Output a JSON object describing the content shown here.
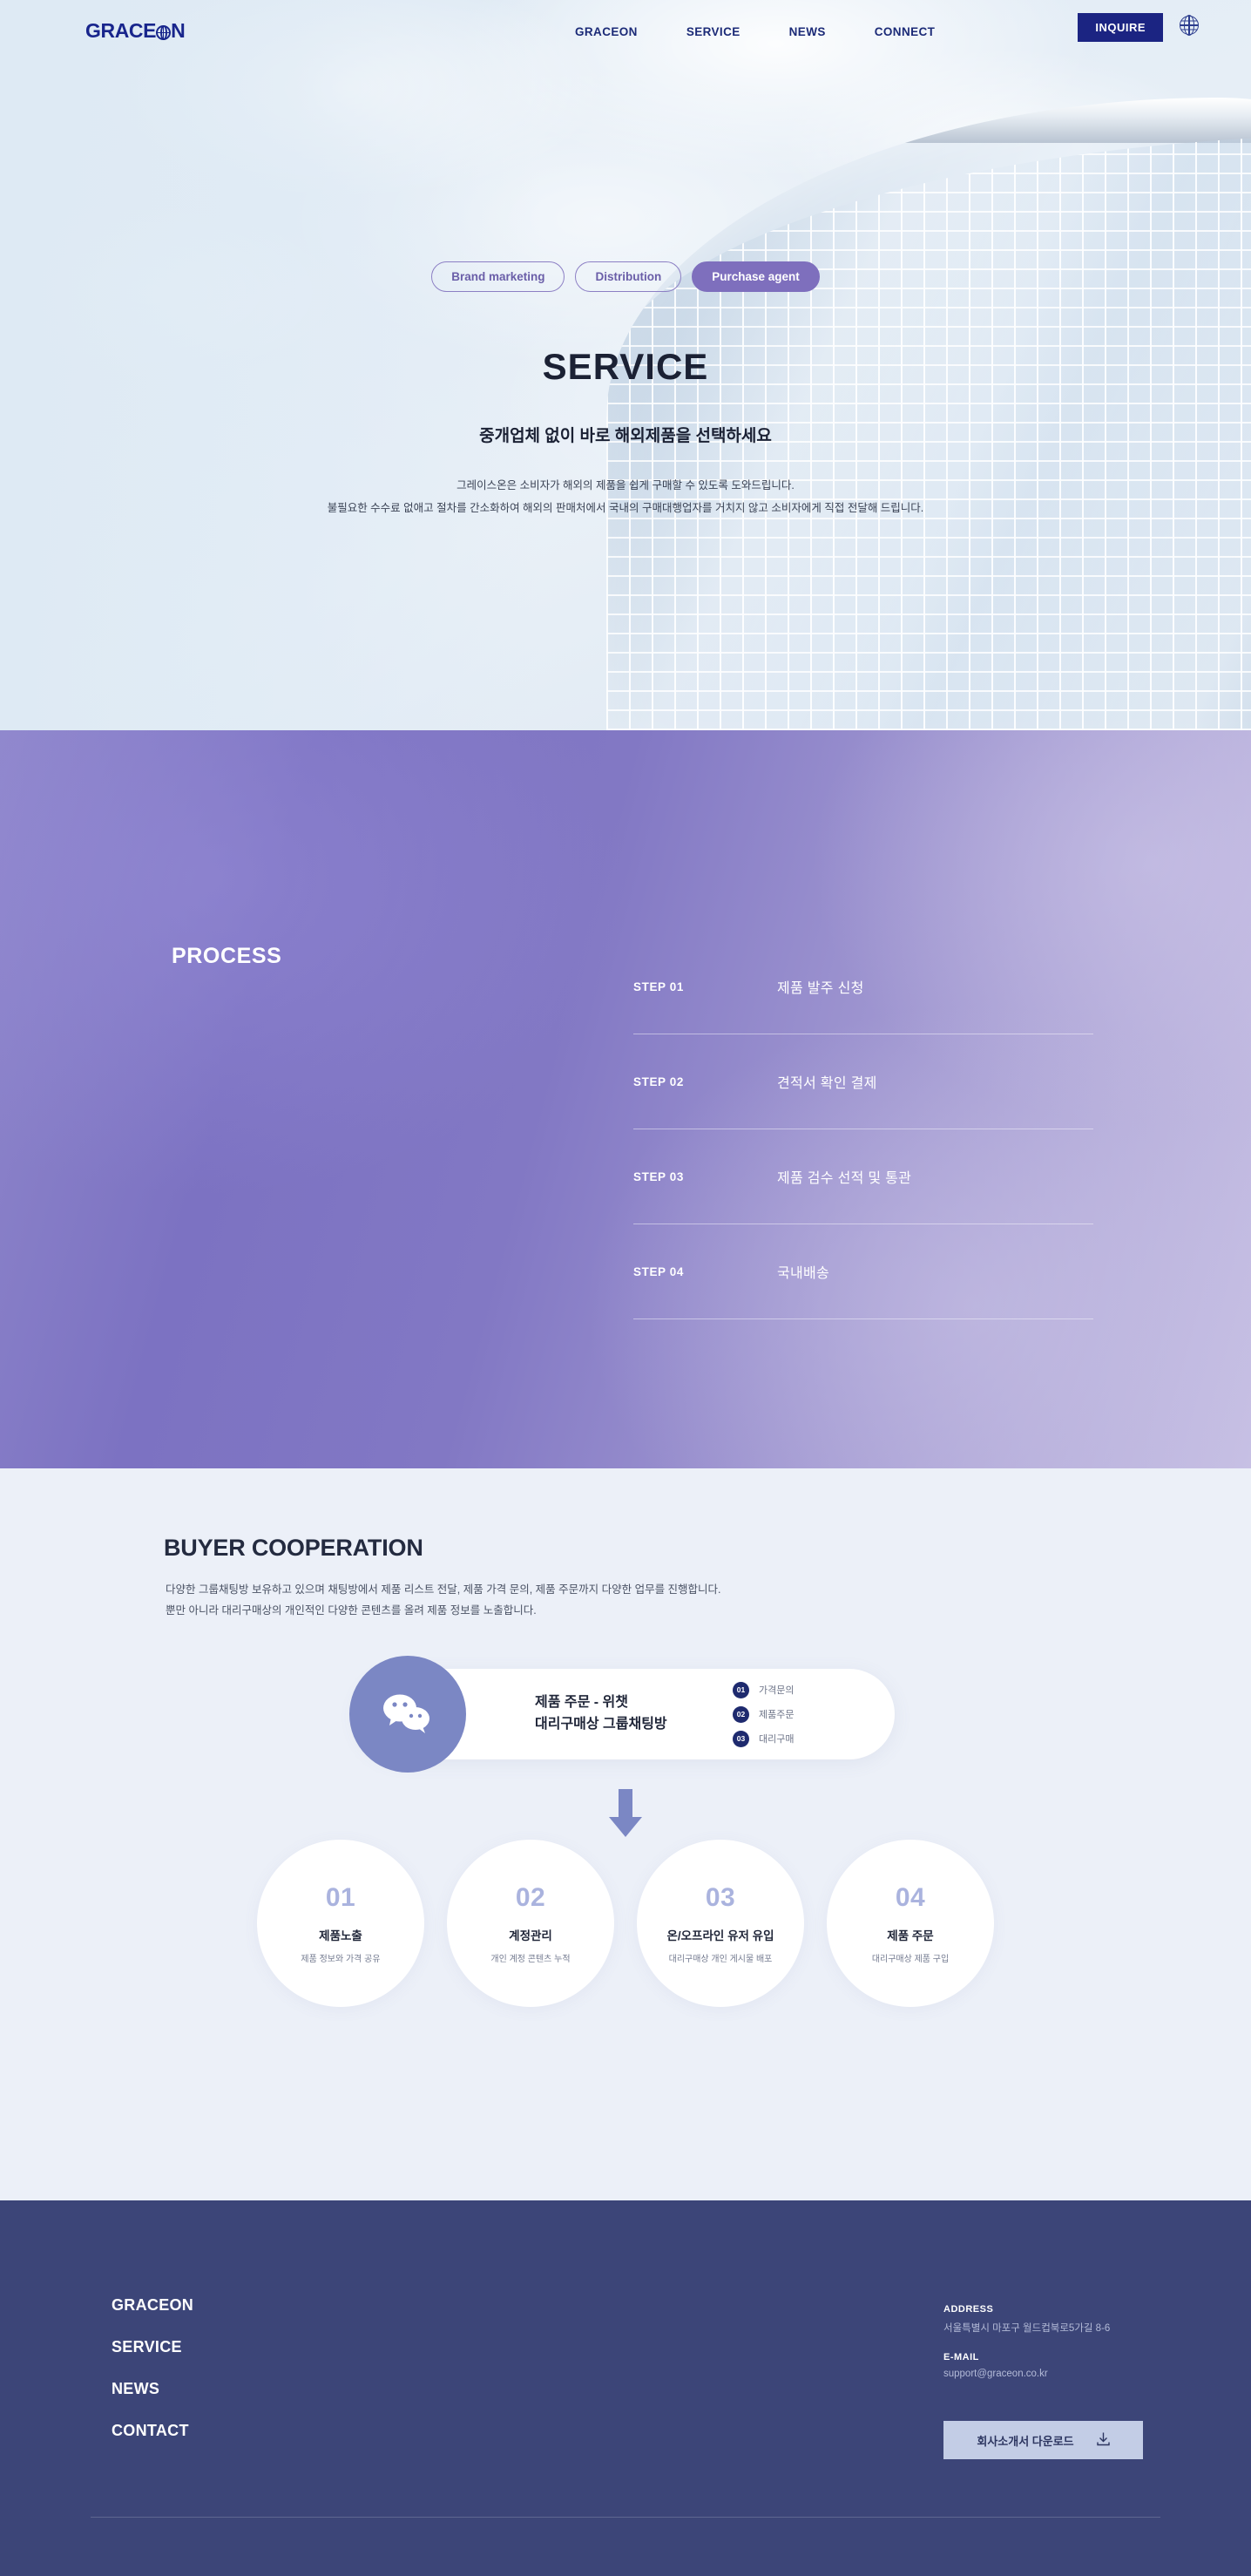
{
  "header": {
    "logo_text_a": "GRACE",
    "logo_globe": "globe-icon",
    "logo_text_b": "N",
    "nav": [
      {
        "label": "GRACEON"
      },
      {
        "label": "SERVICE"
      },
      {
        "label": "NEWS"
      },
      {
        "label": "CONNECT"
      }
    ],
    "inquire_label": "INQUIRE",
    "lang_icon": "globe-icon"
  },
  "hero": {
    "tabs": [
      {
        "label": "Brand marketing",
        "active": false
      },
      {
        "label": "Distribution",
        "active": false
      },
      {
        "label": "Purchase agent",
        "active": true
      }
    ],
    "title": "SERVICE",
    "subtitle": "중개업체 없이 바로 해외제품을 선택하세요",
    "desc_line1": "그레이스온은 소비자가 해외의 제품을 쉽게 구매할 수 있도록 도와드립니다.",
    "desc_line2": "불필요한 수수료 없애고 절차를 간소화하여 해외의 판매처에서 국내의 구매대행업자를 거치지 않고 소비자에게 직접 전달해 드립니다."
  },
  "process": {
    "title": "PROCESS",
    "steps": [
      {
        "no": "STEP 01",
        "label": "제품 발주 신청"
      },
      {
        "no": "STEP 02",
        "label": "견적서 확인 결제"
      },
      {
        "no": "STEP 03",
        "label": "제품 검수 선적 및 통관"
      },
      {
        "no": "STEP 04",
        "label": "국내배송"
      }
    ]
  },
  "buyer": {
    "title": "BUYER COOPERATION",
    "desc_line1": "다양한 그룹채팅방 보유하고 있으며 채팅방에서 제품 리스트 전달, 제품 가격 문의, 제품 주문까지 다양한 업무를 진행합니다.",
    "desc_line2": "뿐만 아니라 대리구매상의 개인적인 다양한 콘텐츠를 올려 제품 정보를 노출합니다.",
    "card": {
      "icon": "wechat-icon",
      "title_line1": "제품 주문 - 위챗",
      "title_line2": "대리구매상 그룹채팅방",
      "items": [
        {
          "no": "01",
          "label": "가격문의"
        },
        {
          "no": "02",
          "label": "제품주문"
        },
        {
          "no": "03",
          "label": "대리구매"
        }
      ]
    },
    "arrow_icon": "arrow-down-icon",
    "circles": [
      {
        "no": "01",
        "title": "제품노출",
        "desc": "제품 정보와 가격 공유"
      },
      {
        "no": "02",
        "title": "계정관리",
        "desc": "개인 계정 콘텐츠 누적"
      },
      {
        "no": "03",
        "title": "온/오프라인 유저 유입",
        "desc": "대리구매상 개인 게시물 배포"
      },
      {
        "no": "04",
        "title": "제품 주문",
        "desc": "대리구매상 제품 구입"
      }
    ]
  },
  "footer": {
    "nav": [
      {
        "label": "GRACEON"
      },
      {
        "label": "SERVICE"
      },
      {
        "label": "NEWS"
      },
      {
        "label": "CONTACT"
      }
    ],
    "address_label": "ADDRESS",
    "address_value": "서울특별시 마포구 월드컵북로5가길 8-6",
    "email_label": "E-MAIL",
    "email_value": "support@graceon.co.kr",
    "download_label": "회사소개서 다운로드",
    "download_icon": "download-icon"
  },
  "colors": {
    "brand_navy": "#18258c",
    "accent_purple": "#7e6fbd",
    "footer_navy": "#3c4578",
    "light_bg": "#ecf0f8",
    "badge_navy": "#1e2a6e",
    "circle_number": "#aab3de"
  }
}
